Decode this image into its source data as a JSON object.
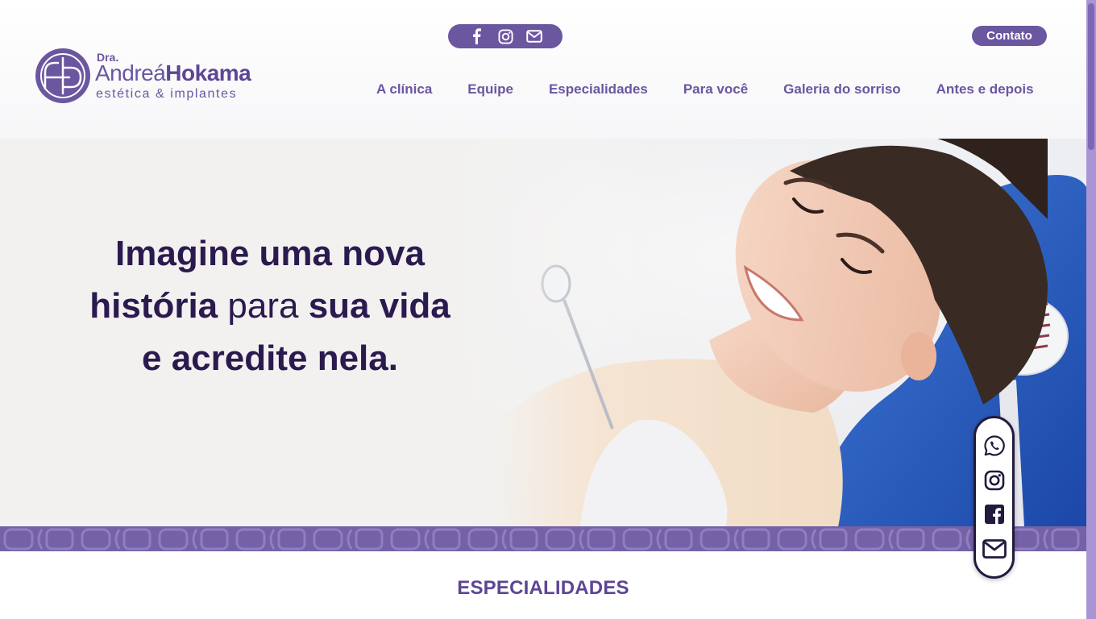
{
  "brand": {
    "prefix": "Dra.",
    "first_name": "Andreá",
    "last_name": "Hokama",
    "tagline": "estética & implantes",
    "color": "#6b56a0"
  },
  "header": {
    "social_icons": [
      "facebook-icon",
      "instagram-icon",
      "mail-icon"
    ],
    "contact_label": "Contato",
    "nav": [
      "A clínica",
      "Equipe",
      "Especialidades",
      "Para você",
      "Galeria do sorriso",
      "Antes e depois"
    ]
  },
  "hero": {
    "line1": "Imagine uma nova",
    "line2_a": "história",
    "line2_b": "para",
    "line2_c": "sua vida",
    "line3": "e acredite nela.",
    "text_color": "#2b1a4e"
  },
  "section": {
    "title": "ESPECIALIDADES"
  },
  "floating_bar": {
    "icons": [
      "whatsapp-icon",
      "instagram-icon",
      "facebook-icon",
      "mail-icon"
    ]
  }
}
